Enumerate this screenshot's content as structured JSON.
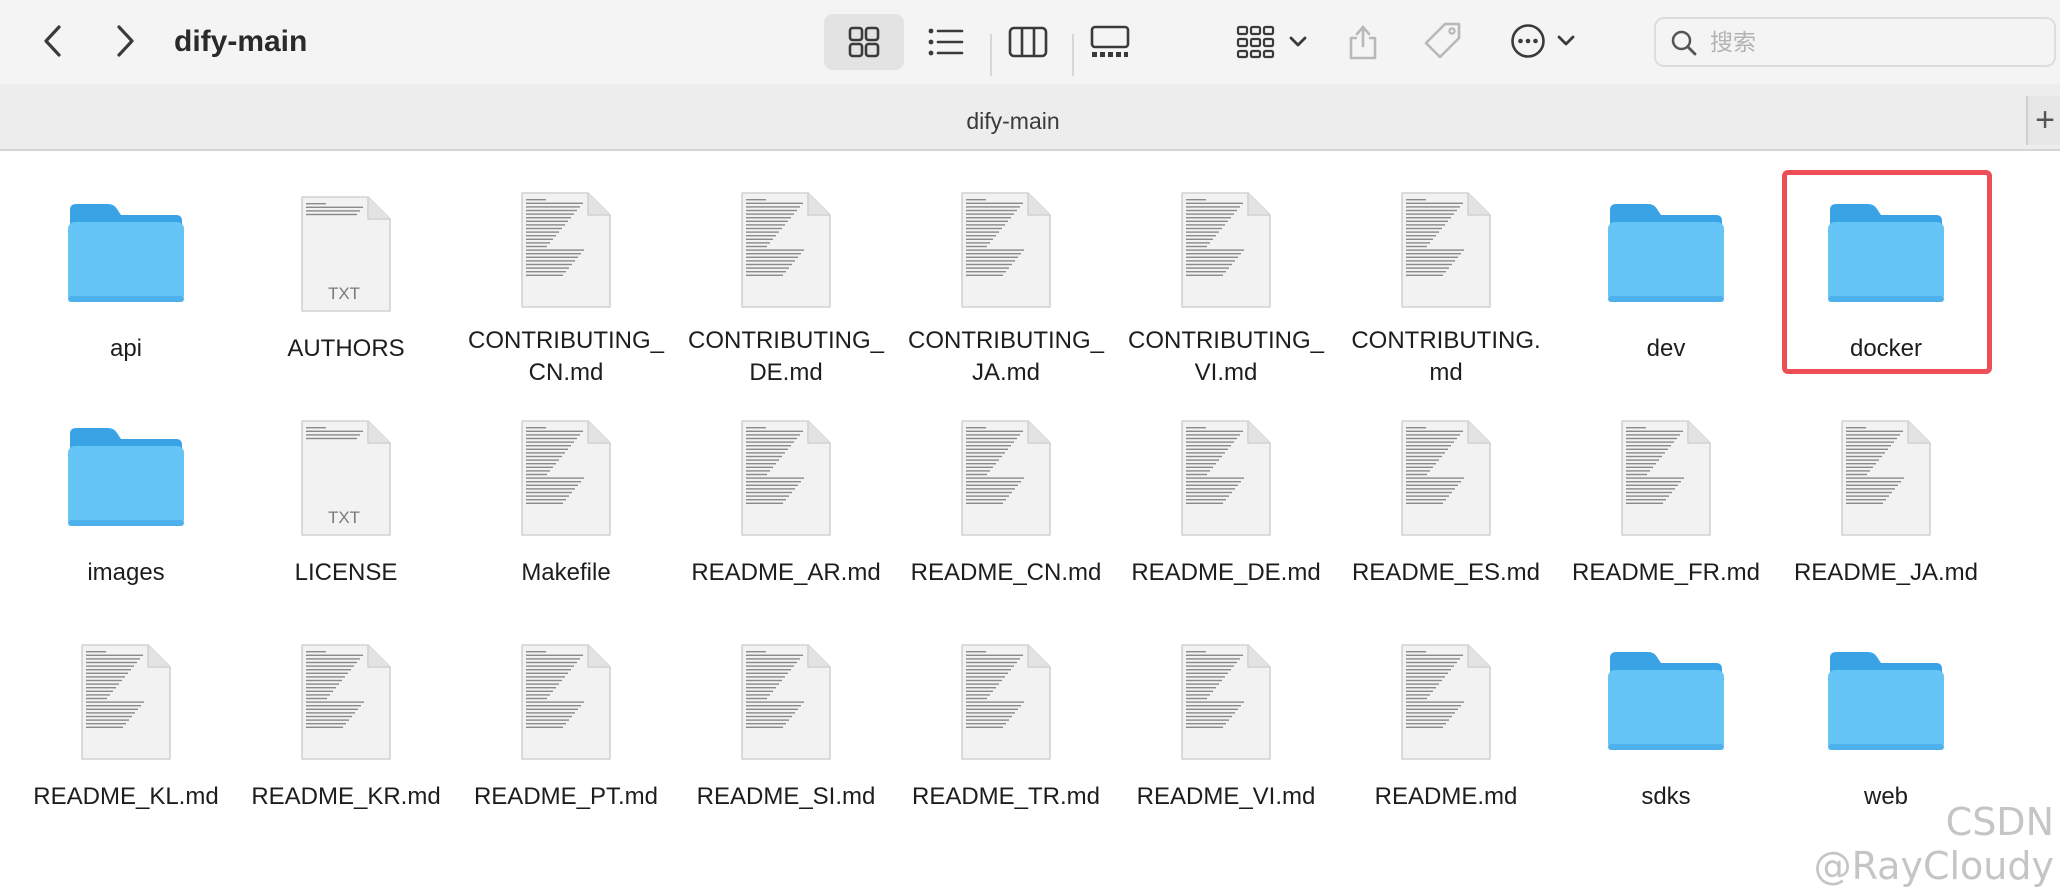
{
  "window": {
    "title": "dify-main",
    "tab_title": "dify-main",
    "new_tab_label": "+"
  },
  "toolbar": {
    "back_icon": "chevron-left-icon",
    "forward_icon": "chevron-right-icon",
    "views": [
      "icon-view",
      "list-view",
      "column-view",
      "gallery-view"
    ],
    "active_view": "icon-view",
    "group_icon": "group-by-icon",
    "share_icon": "share-icon",
    "tag_icon": "tag-icon",
    "more_icon": "ellipsis-circle-icon"
  },
  "search": {
    "placeholder": "搜索",
    "value": ""
  },
  "colors": {
    "folder": "#64c5f6",
    "folder_tab": "#3aa3e6",
    "highlight": "#ee4e55",
    "toolbar_bg": "#f5f4f4"
  },
  "files": [
    {
      "name": "api",
      "kind": "folder"
    },
    {
      "name": "AUTHORS",
      "kind": "txt",
      "badge": "TXT"
    },
    {
      "name": "CONTRIBUTING_\nCN.md",
      "kind": "md"
    },
    {
      "name": "CONTRIBUTING_\nDE.md",
      "kind": "md"
    },
    {
      "name": "CONTRIBUTING_\nJA.md",
      "kind": "md"
    },
    {
      "name": "CONTRIBUTING_\nVI.md",
      "kind": "md"
    },
    {
      "name": "CONTRIBUTING.\nmd",
      "kind": "md"
    },
    {
      "name": "dev",
      "kind": "folder"
    },
    {
      "name": "docker",
      "kind": "folder",
      "selected": true
    },
    {
      "name": "images",
      "kind": "folder"
    },
    {
      "name": "LICENSE",
      "kind": "txt",
      "badge": "TXT"
    },
    {
      "name": "Makefile",
      "kind": "md"
    },
    {
      "name": "README_AR.md",
      "kind": "md"
    },
    {
      "name": "README_CN.md",
      "kind": "md"
    },
    {
      "name": "README_DE.md",
      "kind": "md"
    },
    {
      "name": "README_ES.md",
      "kind": "md"
    },
    {
      "name": "README_FR.md",
      "kind": "md"
    },
    {
      "name": "README_JA.md",
      "kind": "md"
    },
    {
      "name": "README_KL.md",
      "kind": "md"
    },
    {
      "name": "README_KR.md",
      "kind": "md"
    },
    {
      "name": "README_PT.md",
      "kind": "md"
    },
    {
      "name": "README_SI.md",
      "kind": "md"
    },
    {
      "name": "README_TR.md",
      "kind": "md"
    },
    {
      "name": "README_VI.md",
      "kind": "md"
    },
    {
      "name": "README.md",
      "kind": "md"
    },
    {
      "name": "sdks",
      "kind": "folder"
    },
    {
      "name": "web",
      "kind": "folder"
    }
  ],
  "watermark": "CSDN @RayCloudy"
}
